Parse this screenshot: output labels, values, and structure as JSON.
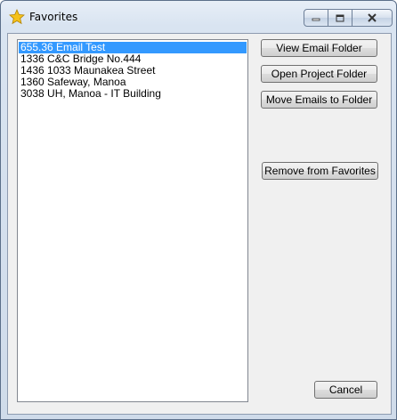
{
  "window": {
    "title": "Favorites"
  },
  "favorites": {
    "items": [
      {
        "label": "655.36 Email Test",
        "selected": true
      },
      {
        "label": "1336 C&C Bridge No.444",
        "selected": false
      },
      {
        "label": "1436 1033 Maunakea Street",
        "selected": false
      },
      {
        "label": "1360 Safeway, Manoa",
        "selected": false
      },
      {
        "label": "3038 UH, Manoa - IT Building",
        "selected": false
      }
    ]
  },
  "buttons": {
    "view_email_folder": "View Email Folder",
    "open_project_folder": "Open Project Folder",
    "move_emails_to_folder": "Move Emails to Folder",
    "remove_from_favorites": "Remove from Favorites",
    "cancel": "Cancel"
  },
  "colors": {
    "selection": "#3399ff",
    "star": "#f5c21b"
  }
}
